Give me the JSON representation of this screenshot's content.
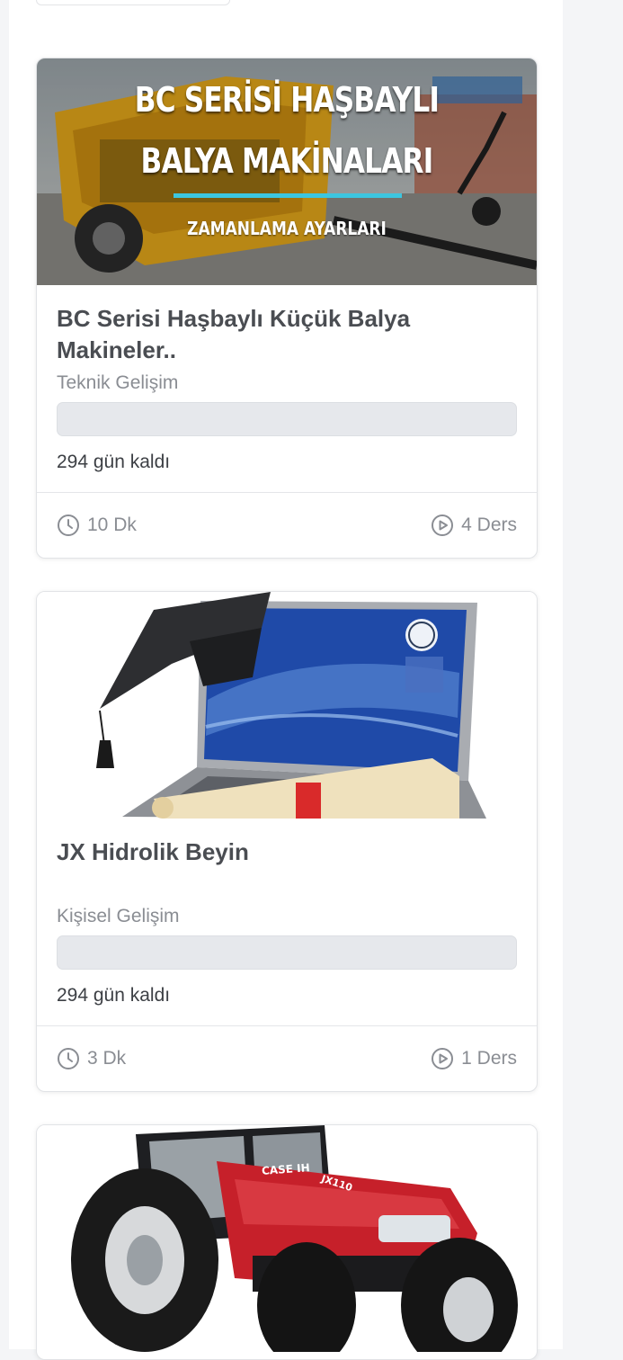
{
  "courses": [
    {
      "banner": {
        "line1": "BC SERİSİ HAŞBAYLI",
        "line2": "BALYA MAKİNALARI",
        "line3": "ZAMANLAMA AYARLARI"
      },
      "image_icon": "baler-machine-photo",
      "title": "BC Serisi Haşbaylı Küçük Balya Makineler..",
      "category": "Teknik Gelişim",
      "progress": 0,
      "remaining": "294 gün kaldı",
      "duration": "10 Dk",
      "lessons": "4 Ders"
    },
    {
      "image_icon": "graduation-laptop-photo",
      "title": "JX Hidrolik Beyin",
      "category": "Kişisel Gelişim",
      "progress": 0,
      "remaining": "294 gün kaldı",
      "duration": "3 Dk",
      "lessons": "1 Ders"
    },
    {
      "image_icon": "red-tractor-photo",
      "tractor_brand": "CASE IH",
      "tractor_model": "JX110"
    }
  ],
  "colors": {
    "accent_line": "#3cc6e0",
    "tractor_red": "#c6202a",
    "text_dark": "#4a4d52",
    "text_muted": "#8a8d93"
  }
}
